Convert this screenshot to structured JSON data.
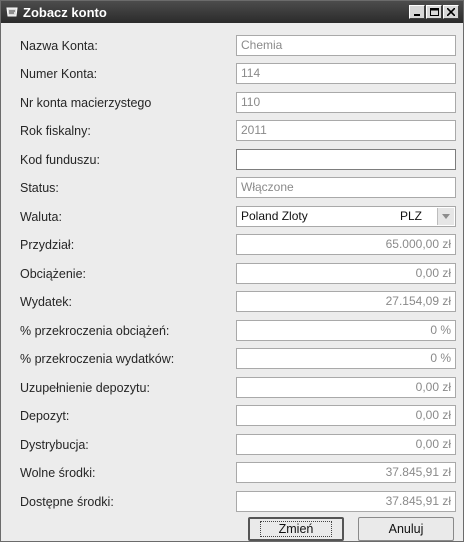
{
  "window": {
    "title": "Zobacz konto"
  },
  "fields": [
    {
      "label": "Nazwa Konta:",
      "value": "Chemia",
      "kind": "text"
    },
    {
      "label": "Numer Konta:",
      "value": "114",
      "kind": "text"
    },
    {
      "label": "Nr konta macierzystego",
      "value": "110",
      "kind": "text"
    },
    {
      "label": "Rok fiskalny:",
      "value": "2011",
      "kind": "text"
    },
    {
      "label": "Kod funduszu:",
      "value": "",
      "kind": "text"
    },
    {
      "label": "Status:",
      "value": "Włączone",
      "kind": "text"
    },
    {
      "label": "Waluta:",
      "value": "Poland Zloty",
      "code": "PLZ",
      "kind": "select"
    },
    {
      "label": "Przydział:",
      "value": "65.000,00 zł",
      "kind": "num"
    },
    {
      "label": "Obciążenie:",
      "value": "0,00 zł",
      "kind": "num"
    },
    {
      "label": "Wydatek:",
      "value": "27.154,09 zł",
      "kind": "num"
    },
    {
      "label": "% przekroczenia obciążeń:",
      "value": "0 %",
      "kind": "num"
    },
    {
      "label": "% przekroczenia wydatków:",
      "value": "0 %",
      "kind": "num"
    },
    {
      "label": "Uzupełnienie depozytu:",
      "value": "0,00 zł",
      "kind": "num"
    },
    {
      "label": "Depozyt:",
      "value": "0,00 zł",
      "kind": "num"
    },
    {
      "label": "Dystrybucja:",
      "value": "0,00 zł",
      "kind": "num"
    },
    {
      "label": "Wolne środki:",
      "value": "37.845,91 zł",
      "kind": "num"
    },
    {
      "label": "Dostępne środki:",
      "value": "37.845,91 zł",
      "kind": "num"
    }
  ],
  "buttons": {
    "change": "Zmień",
    "cancel": "Anuluj"
  }
}
